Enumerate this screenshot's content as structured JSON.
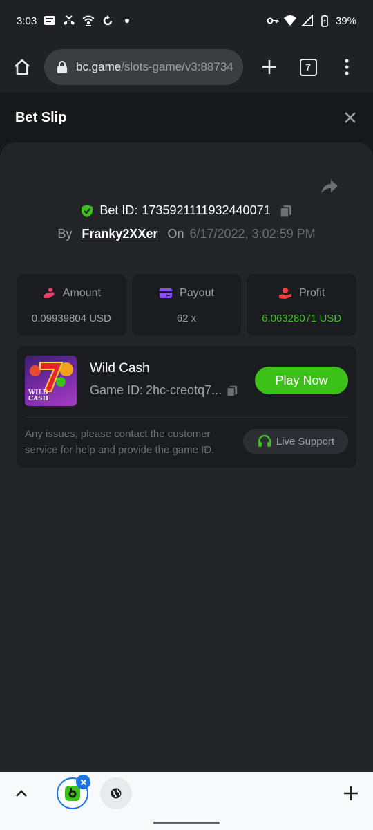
{
  "status_bar": {
    "time": "3:03",
    "battery": "39%"
  },
  "browser": {
    "url_host": "bc.game",
    "url_path": "/slots-game/v3:88734",
    "tab_count": "7"
  },
  "bet_slip": {
    "title": "Bet Slip",
    "bet_id_label": "Bet ID:",
    "bet_id": "1735921111932440071",
    "by_label": "By",
    "username": "Franky2XXer",
    "on_label": "On",
    "datetime": "6/17/2022, 3:02:59 PM",
    "stats": [
      {
        "label": "Amount",
        "value": "0.09939804 USD",
        "icon": "amount-icon",
        "color": "#f03e6b"
      },
      {
        "label": "Payout",
        "value": "62 x",
        "icon": "payout-icon",
        "color": "#8a4dff"
      },
      {
        "label": "Profit",
        "value": "6.06328071 USD",
        "icon": "profit-icon",
        "color": "#ff3d3d"
      }
    ],
    "game": {
      "name": "Wild Cash",
      "id_label": "Game ID:",
      "id_value": "2hc-creotq7...",
      "play_label": "Play Now",
      "thumb_text_1": "WILD",
      "thumb_text_2": "CASH"
    },
    "issue_text": "Any issues, please contact the customer service for help and provide the game ID.",
    "support_label": "Live Support"
  },
  "colors": {
    "accent_green": "#3bc117",
    "chrome_blue": "#1a73e8"
  }
}
